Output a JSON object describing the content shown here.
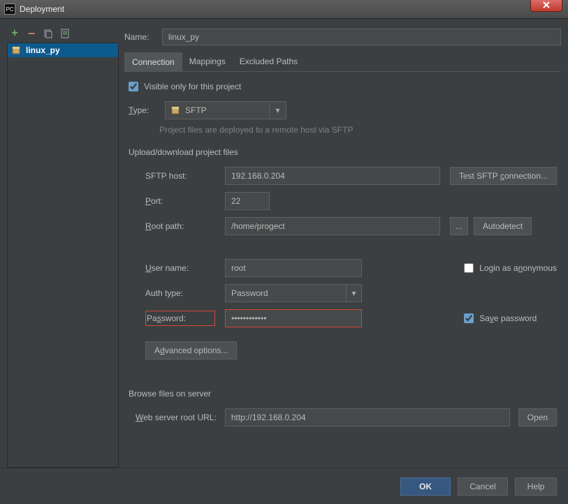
{
  "window": {
    "title": "Deployment"
  },
  "sidebar": {
    "items": [
      {
        "label": "linux_py"
      }
    ]
  },
  "name_label": "Name:",
  "name_value": "linux_py",
  "tabs": {
    "connection": "Connection",
    "mappings": "Mappings",
    "excluded": "Excluded Paths"
  },
  "visible_only_label": "Visible only for this project",
  "type_label": "Type:",
  "type_value": "SFTP",
  "type_hint": "Project files are deployed to a remote host via SFTP",
  "upload_section": "Upload/download project files",
  "fields": {
    "sftp_host_label": "SFTP host:",
    "sftp_host_value": "192.168.0.204",
    "test_btn": "Test SFTP connection...",
    "port_label": "Port:",
    "port_value": "22",
    "root_label": "Root path:",
    "root_value": "/home/progect",
    "autodetect_btn": "Autodetect",
    "user_label": "User name:",
    "user_value": "root",
    "anon_label": "Login as anonymous",
    "auth_label": "Auth type:",
    "auth_value": "Password",
    "password_label": "Password:",
    "password_value": "••••••••••••",
    "save_pw_label": "Save password",
    "advanced_btn": "Advanced options..."
  },
  "browse_section": "Browse files on server",
  "web_url_label": "Web server root URL:",
  "web_url_value": "http://192.168.0.204",
  "open_btn": "Open",
  "buttons": {
    "ok": "OK",
    "cancel": "Cancel",
    "help": "Help"
  }
}
